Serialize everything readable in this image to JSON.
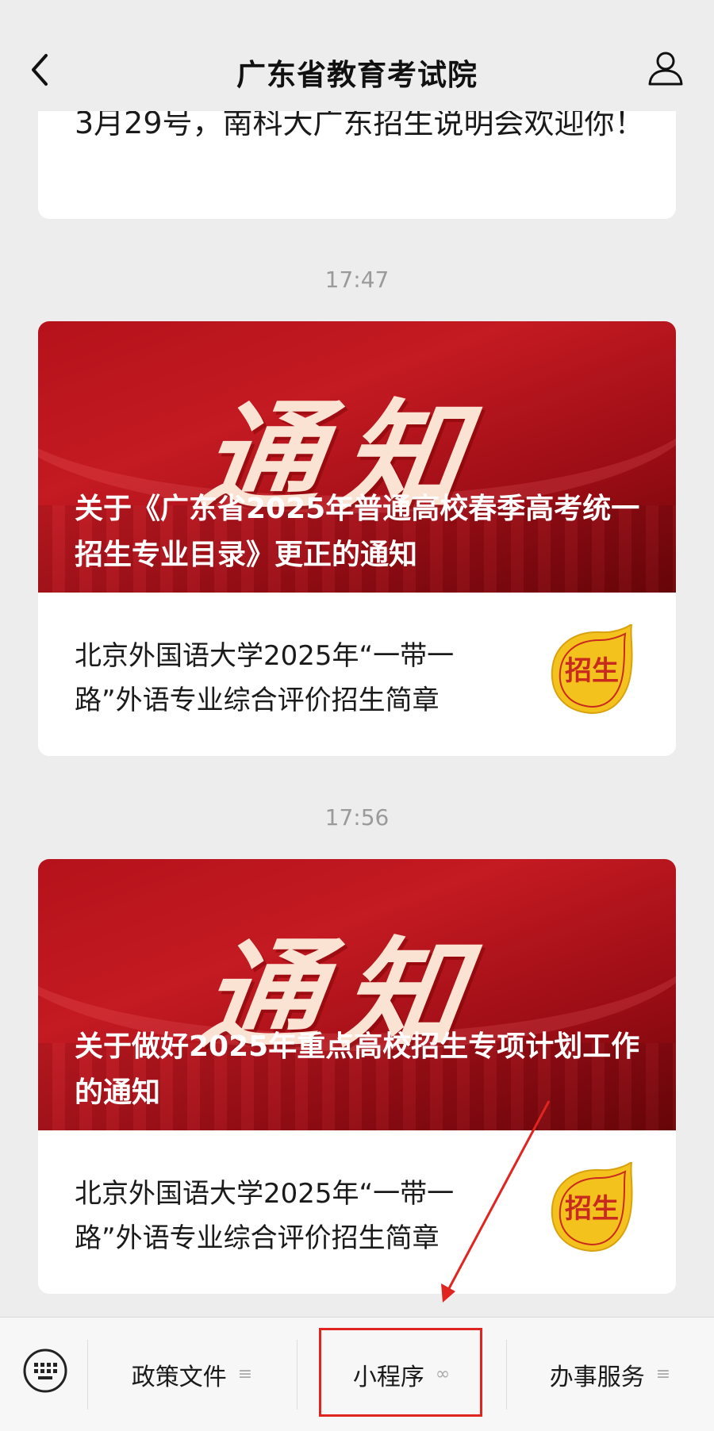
{
  "header": {
    "title": "广东省教育考试院"
  },
  "feed": {
    "top_card_text": "3月29号，南科大广东招生说明会欢迎你！",
    "messages": [
      {
        "time": "17:47",
        "banner_word": "通知",
        "headline": "关于《广东省2025年普通高校春季高考统一招生专业目录》更正的通知",
        "sub_title": "北京外国语大学2025年“一带一路”外语专业综合评价招生简章",
        "badge_text": "招生"
      },
      {
        "time": "17:56",
        "banner_word": "通知",
        "headline": "关于做好2025年重点高校招生专项计划工作的通知",
        "sub_title": "北京外国语大学2025年“一带一路”外语专业综合评价招生简章",
        "badge_text": "招生"
      }
    ]
  },
  "bottom_menu": {
    "items": [
      {
        "label": "政策文件",
        "suffix": "≡"
      },
      {
        "label": "小程序",
        "suffix": "∞"
      },
      {
        "label": "办事服务",
        "suffix": "≡"
      }
    ]
  },
  "colors": {
    "banner_red": "#b5121b",
    "highlight_red": "#e0241f",
    "badge_yellow": "#f4c21d"
  }
}
